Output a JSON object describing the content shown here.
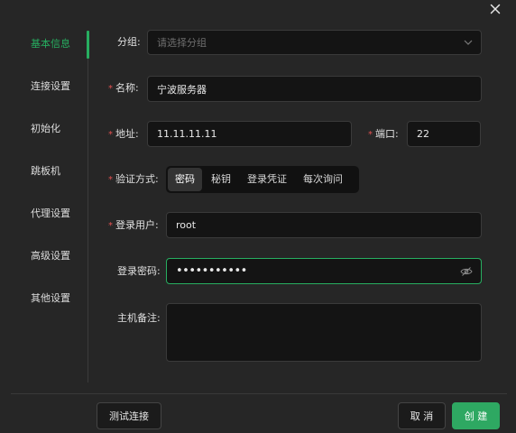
{
  "sidebar": {
    "items": [
      {
        "label": "基本信息"
      },
      {
        "label": "连接设置"
      },
      {
        "label": "初始化"
      },
      {
        "label": "跳板机"
      },
      {
        "label": "代理设置"
      },
      {
        "label": "高级设置"
      },
      {
        "label": "其他设置"
      }
    ],
    "active_index": 0
  },
  "form": {
    "group": {
      "label": "分组:",
      "placeholder": "请选择分组"
    },
    "name": {
      "label": "名称:",
      "value": "宁波服务器",
      "required": true
    },
    "address": {
      "label": "地址:",
      "value": "11.11.11.11",
      "required": true
    },
    "port": {
      "label": "端口:",
      "value": "22",
      "required": true
    },
    "auth": {
      "label": "验证方式:",
      "required": true,
      "options": [
        "密码",
        "秘钥",
        "登录凭证",
        "每次询问"
      ],
      "selected": "密码"
    },
    "username": {
      "label": "登录用户:",
      "value": "root",
      "required": true
    },
    "password": {
      "label": "登录密码:",
      "value": "•••••••••••"
    },
    "remark": {
      "label": "主机备注:",
      "value": ""
    }
  },
  "footer": {
    "test_label": "测试连接",
    "cancel_label": "取 消",
    "create_label": "创 建"
  },
  "colors": {
    "accent": "#27ae60",
    "required": "#e05050",
    "background": "#262626",
    "input_bg": "#141414"
  },
  "icons": {
    "close": "close-icon",
    "select_arrow": "chevron-down-icon",
    "password_toggle": "eye-off-icon"
  }
}
